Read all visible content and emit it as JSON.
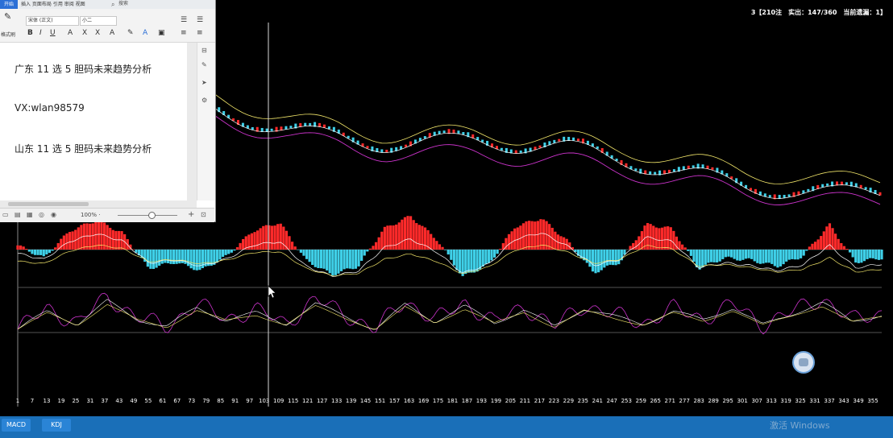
{
  "info_bar": "3【210注　实出：147/360　当前遗漏：1】",
  "x_ticks": [
    "1",
    "7",
    "13",
    "19",
    "25",
    "31",
    "37",
    "43",
    "49",
    "55",
    "61",
    "67",
    "73",
    "79",
    "85",
    "91",
    "97",
    "103",
    "109",
    "115",
    "121",
    "127",
    "133",
    "139",
    "145",
    "151",
    "157",
    "163",
    "169",
    "175",
    "181",
    "187",
    "193",
    "199",
    "205",
    "211",
    "217",
    "223",
    "229",
    "235",
    "241",
    "247",
    "253",
    "259",
    "265",
    "271",
    "277",
    "283",
    "289",
    "295",
    "301",
    "307",
    "313",
    "319",
    "325",
    "331",
    "337",
    "343",
    "349",
    "355"
  ],
  "bottom_tabs": [
    "MACD",
    "KDJ"
  ],
  "watermark": "激活 Windows",
  "word": {
    "tab_active": "开始",
    "tabs_rest": "插入 页面布局 引用 审阅 视图",
    "search_label": "搜索",
    "format_painter": "格式刷",
    "font_name": "宋体 (正文)",
    "font_size": "小二",
    "zoom": "100% ·",
    "doc_lines": [
      "广东 11 选 5 胆码未来趋势分析",
      "VX:wlan98579",
      "山东 11 选 5 胆码未来趋势分析"
    ]
  },
  "colors": {
    "up": "#ff2a2a",
    "down": "#3fd0e8",
    "ma_yellow": "#f2e66a",
    "ma_white": "#ffffff",
    "ma_purple": "#cc33cc",
    "axis": "#8a8a8a"
  },
  "chart_data": [
    {
      "type": "line",
      "title": "",
      "series": [
        {
          "values": [
            88,
            87,
            86,
            85,
            84,
            82,
            80,
            79,
            77,
            76,
            75,
            73,
            72,
            70,
            69,
            68,
            66,
            65,
            63,
            62
          ]
        }
      ]
    },
    {
      "type": "bar",
      "title": "MACD",
      "values": [
        0.2,
        -0.4,
        0.9,
        1.4,
        0.8,
        -0.9,
        -0.6,
        -1.0,
        -0.3,
        0.9,
        1.3,
        -0.5,
        -1.2,
        -0.8,
        1.0,
        1.6,
        0.5,
        -1.3,
        -0.7,
        1.1,
        1.5,
        0.4,
        -1.1,
        -0.6,
        1.2,
        1.0,
        -0.9,
        -0.4,
        -0.5,
        -0.8,
        -0.3,
        1.2,
        -0.6,
        -0.4
      ]
    },
    {
      "type": "line",
      "title": "KDJ",
      "series": [
        {
          "values": [
            30,
            65,
            40,
            85,
            50,
            35,
            72,
            48,
            62,
            40,
            80,
            55,
            30,
            78,
            45,
            75,
            42,
            68,
            35,
            70,
            55,
            40,
            65,
            48,
            72,
            38,
            60,
            82,
            45,
            58
          ]
        }
      ]
    }
  ]
}
